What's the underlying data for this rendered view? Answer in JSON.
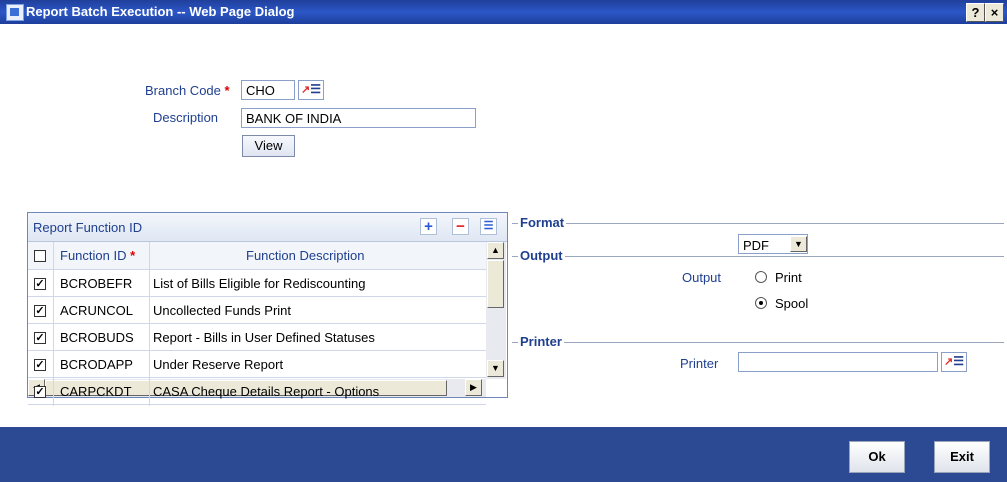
{
  "window": {
    "title": "Report Batch Execution -- Web Page Dialog",
    "help_label": "?",
    "close_label": "×"
  },
  "form": {
    "branch_code_label": "Branch Code",
    "branch_code_value": "CHO",
    "description_label": "Description",
    "description_value": "BANK OF INDIA",
    "view_label": "View",
    "required_mark": "*"
  },
  "grid": {
    "title": "Report Function ID",
    "add_label": "+",
    "remove_label": "−",
    "columns": [
      "Function ID",
      "Function Description"
    ],
    "rows": [
      {
        "id": "BCROBEFR",
        "description": "List of Bills Eligible for Rediscounting",
        "checked": true
      },
      {
        "id": "ACRUNCOL",
        "description": "Uncollected Funds Print",
        "checked": true
      },
      {
        "id": "BCROBUDS",
        "description": "Report - Bills in User Defined Statuses",
        "checked": true
      },
      {
        "id": "BCRODAPP",
        "description": "Under Reserve Report",
        "checked": true
      },
      {
        "id": "CARPCKDT",
        "description": "CASA Cheque Details Report - Options",
        "checked": true
      }
    ]
  },
  "format": {
    "section_label": "Format",
    "selected": "PDF"
  },
  "output": {
    "section_label": "Output",
    "field_label": "Output",
    "options": [
      {
        "label": "Print",
        "selected": false
      },
      {
        "label": "Spool",
        "selected": true
      }
    ]
  },
  "printer": {
    "section_label": "Printer",
    "field_label": "Printer",
    "value": ""
  },
  "footer": {
    "ok_label": "Ok",
    "exit_label": "Exit"
  }
}
